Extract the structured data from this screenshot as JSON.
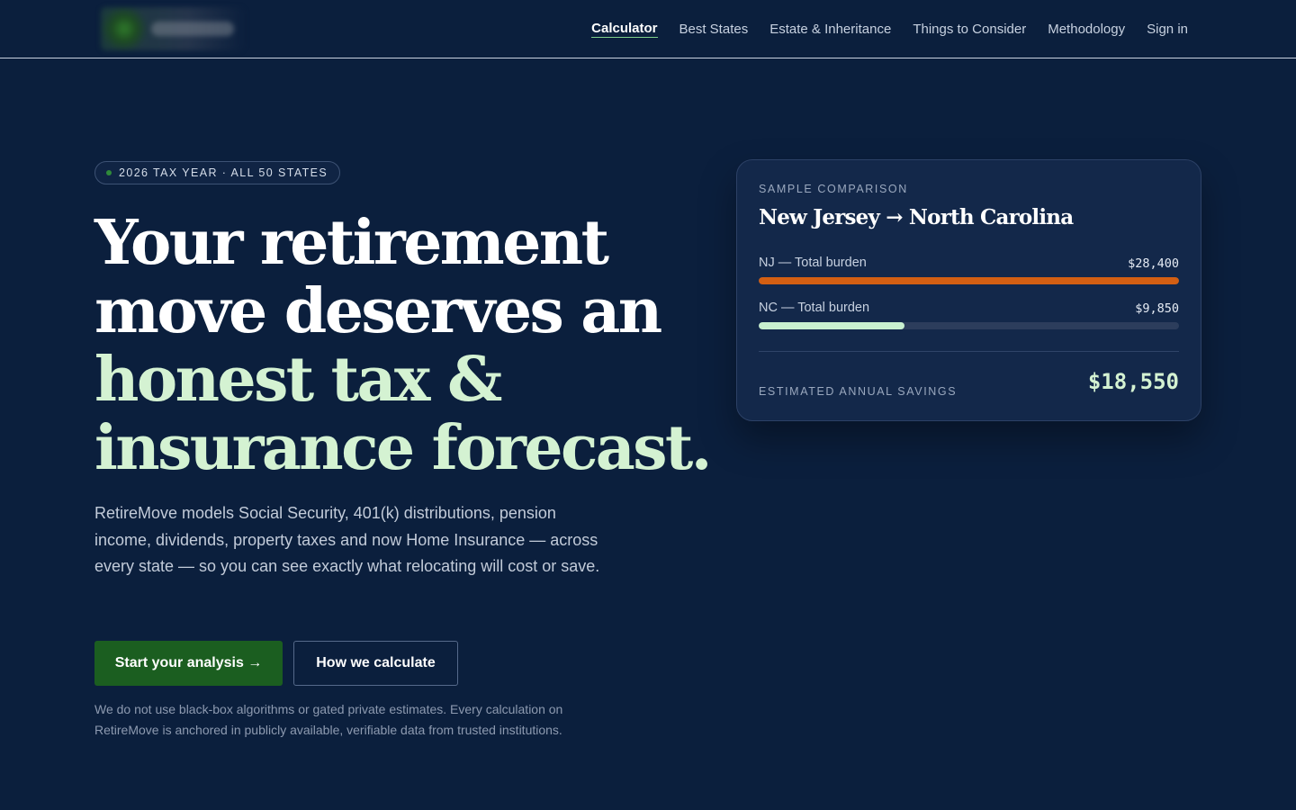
{
  "nav": {
    "links": [
      {
        "label": "Calculator",
        "active": true
      },
      {
        "label": "Best States",
        "active": false
      },
      {
        "label": "Estate & Inheritance",
        "active": false
      },
      {
        "label": "Things to Consider",
        "active": false
      },
      {
        "label": "Methodology",
        "active": false
      },
      {
        "label": "Sign in",
        "active": false
      }
    ]
  },
  "hero": {
    "badge": "2026 TAX YEAR · ALL 50 STATES",
    "headline": {
      "line1": "Your retirement",
      "line2": "move deserves an",
      "line3": "honest tax &",
      "line4": "insurance forecast."
    },
    "lead": "RetireMove models Social Security, 401(k) distributions, pension income, dividends, property taxes and now Home Insurance — across every state — so you can see exactly what relocating will cost or save.",
    "primary_cta": "Start your analysis →",
    "secondary_cta": "How we calculate",
    "disclaimer": "We do not use black-box algorithms or gated private estimates. Every calculation on RetireMove is anchored in publicly available, verifiable data from trusted institutions."
  },
  "card": {
    "eyebrow": "SAMPLE COMPARISON",
    "title": "New Jersey → North Carolina",
    "rows": [
      {
        "label": "NJ — Total burden",
        "value": "$28,400",
        "fill": 1.0,
        "color": "#d35f13"
      },
      {
        "label": "NC — Total burden",
        "value": "$9,850",
        "fill": 0.347,
        "color": "#c8f0cf"
      }
    ],
    "savings_label": "ESTIMATED ANNUAL SAVINGS",
    "savings_value": "$18,550"
  },
  "colors": {
    "background": "#0b1f3d",
    "accent_green": "#1b5e20",
    "headline_accent": "#d4f2d2"
  }
}
